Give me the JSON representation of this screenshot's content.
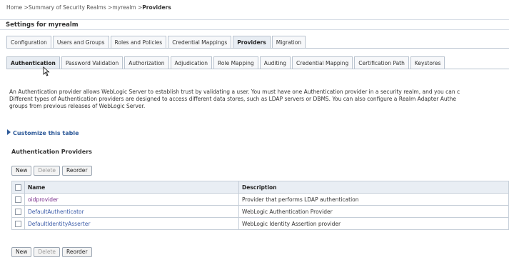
{
  "breadcrumb": {
    "home": "Home",
    "sep": ">",
    "summary": "Summary of Security Realms",
    "realm": "myrealm",
    "current": "Providers"
  },
  "settings_title": "Settings for myrealm",
  "main_tabs": [
    {
      "label": "Configuration"
    },
    {
      "label": "Users and Groups"
    },
    {
      "label": "Roles and Policies"
    },
    {
      "label": "Credential Mappings"
    },
    {
      "label": "Providers"
    },
    {
      "label": "Migration"
    }
  ],
  "sub_tabs": [
    {
      "label": "Authentication"
    },
    {
      "label": "Password Validation"
    },
    {
      "label": "Authorization"
    },
    {
      "label": "Adjudication"
    },
    {
      "label": "Role Mapping"
    },
    {
      "label": "Auditing"
    },
    {
      "label": "Credential Mapping"
    },
    {
      "label": "Certification Path"
    },
    {
      "label": "Keystores"
    }
  ],
  "description": {
    "line1": "An Authentication provider allows WebLogic Server to establish trust by validating a user. You must have one Authentication provider in a security realm, and you can c",
    "line2": "Different types of Authentication providers are designed to access different data stores, such as LDAP servers or DBMS. You can also configure a Realm Adapter Authe",
    "line3": "groups from previous releases of WebLogic Server."
  },
  "customize_label": "Customize this table",
  "section_title": "Authentication Providers",
  "buttons": {
    "new": "New",
    "delete": "Delete",
    "reorder": "Reorder"
  },
  "table": {
    "headers": {
      "name": "Name",
      "description": "Description"
    },
    "rows": [
      {
        "name": "oidprovider",
        "description": "Provider that performs LDAP authentication"
      },
      {
        "name": "DefaultAuthenticator",
        "description": "WebLogic Authentication Provider"
      },
      {
        "name": "DefaultIdentityAsserter",
        "description": "WebLogic Identity Assertion provider"
      }
    ]
  },
  "colors": {
    "link": "#3a5ba8",
    "visited_link": "#7a2f8c",
    "header_bg": "#e9eef4",
    "border": "#c5ced8"
  }
}
